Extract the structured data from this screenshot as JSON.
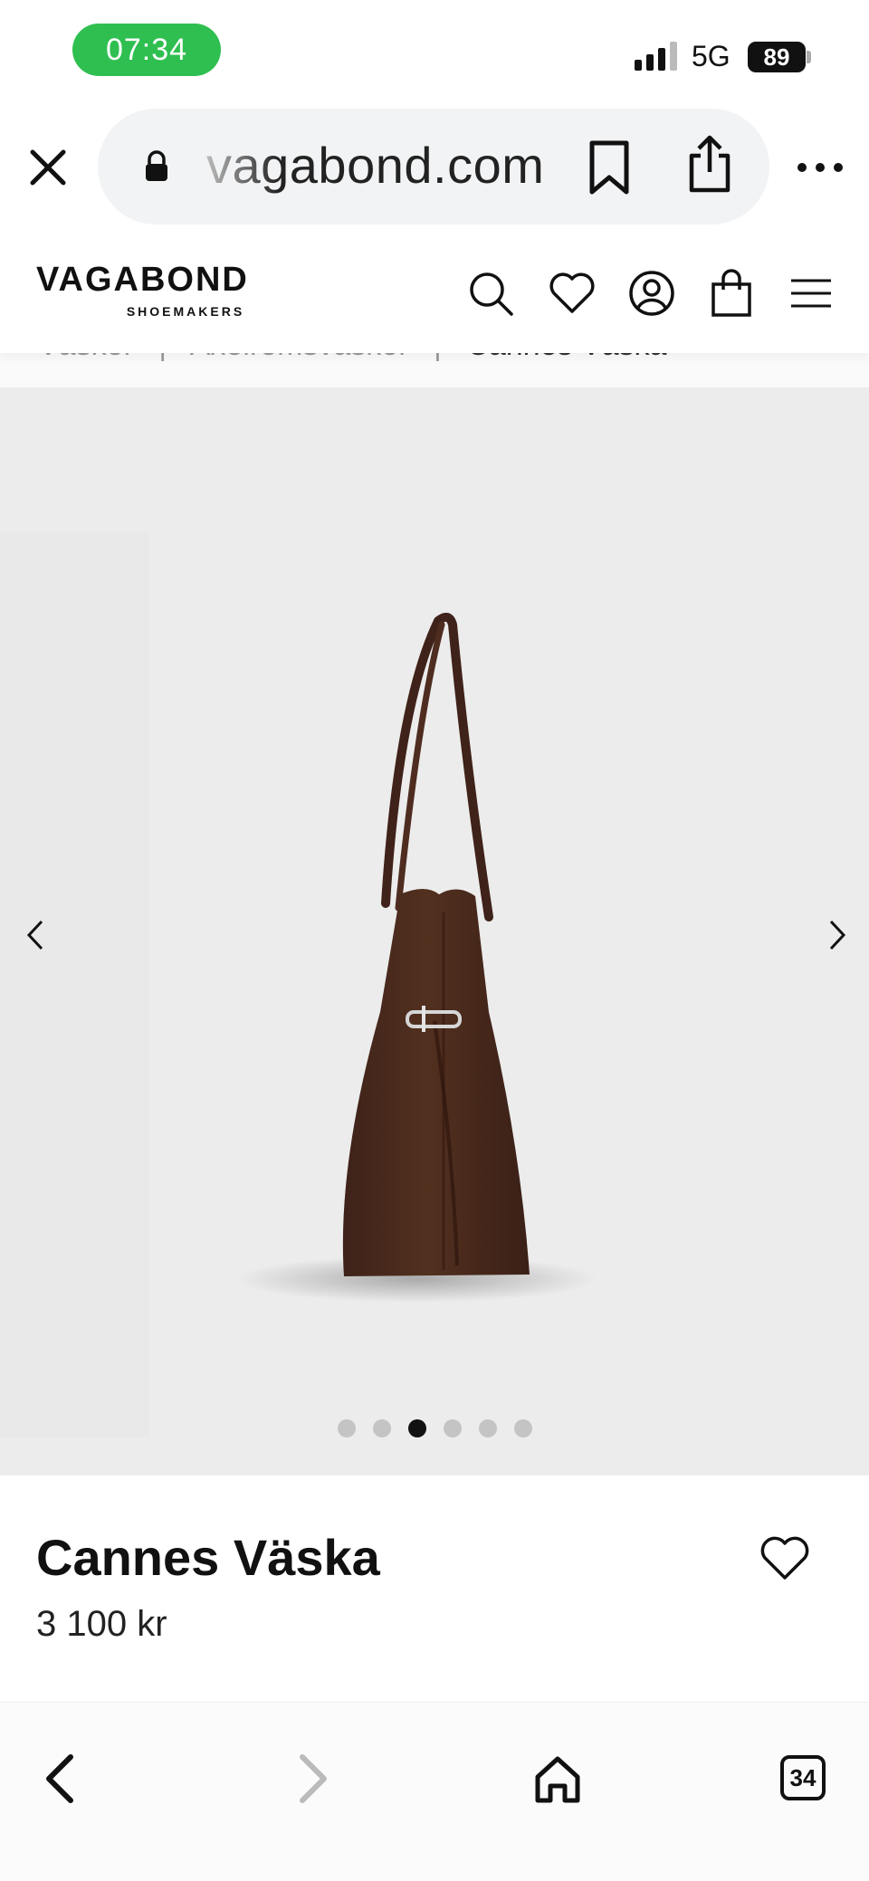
{
  "status_bar": {
    "time": "07:34",
    "network": "5G",
    "battery": "89"
  },
  "browser": {
    "url": "vagabond.com",
    "tabs_count": "34"
  },
  "site": {
    "logo_main": "VAGABOND",
    "logo_sub": "SHOEMAKERS"
  },
  "breadcrumb": {
    "items": [
      "Väskor",
      "Axelremsväskor",
      "Cannes Väska"
    ],
    "separator": "|"
  },
  "gallery": {
    "total_images": 6,
    "active_index": 2,
    "bag_color": "#4a2a1f"
  },
  "product": {
    "title": "Cannes Väska",
    "price": "3 100 kr"
  },
  "colors": {
    "status_green": "#2fbf50",
    "image_bg": "#ececec",
    "text": "#111111"
  },
  "icons": [
    "close-icon",
    "lock-icon",
    "bookmark-icon",
    "share-icon",
    "more-icon",
    "search-icon",
    "heart-icon",
    "account-icon",
    "bag-icon",
    "menu-icon",
    "chevron-left-icon",
    "chevron-right-icon",
    "home-icon"
  ]
}
